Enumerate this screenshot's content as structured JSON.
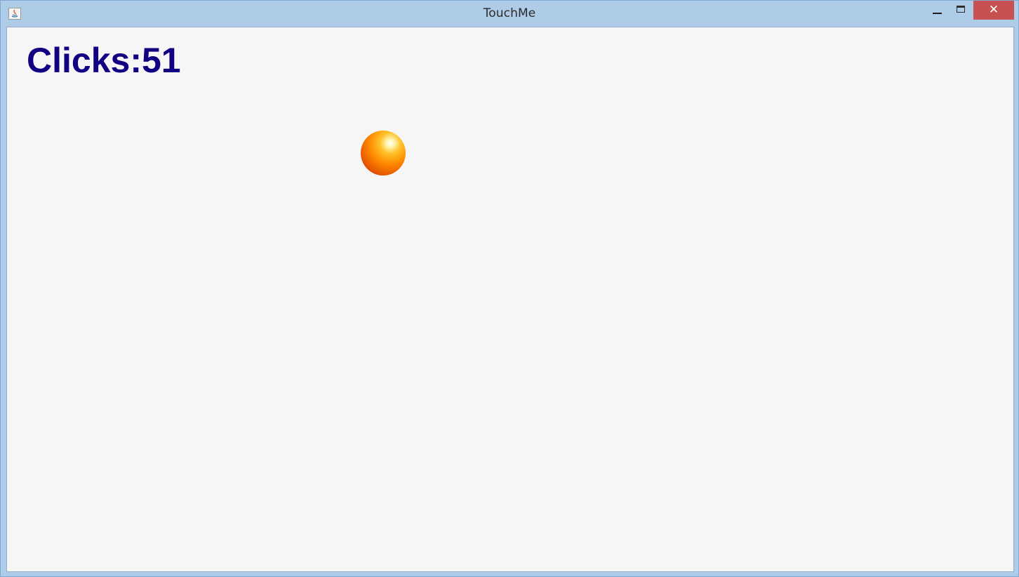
{
  "window": {
    "title": "TouchMe",
    "controls": {
      "minimize_icon": "minimize-icon",
      "maximize_icon": "maximize-icon",
      "close_glyph": "✕"
    },
    "colors": {
      "frame": "#aecbe7",
      "close_button": "#c75050",
      "client_background": "#f6f6f6"
    }
  },
  "game": {
    "score_text": "Clicks:51",
    "score_color": "#120082",
    "ball_icon": "orange-sphere"
  }
}
